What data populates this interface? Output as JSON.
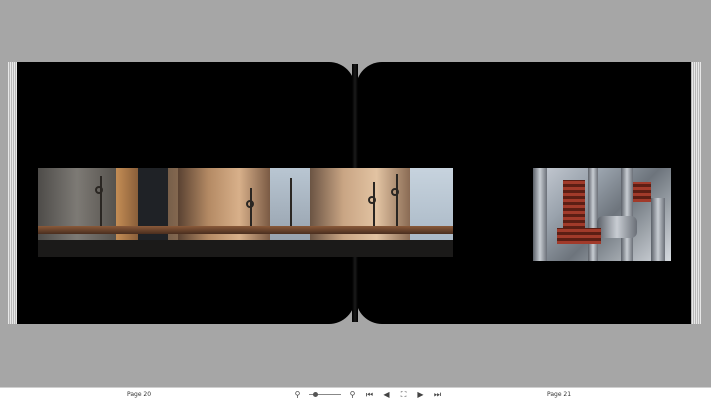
{
  "viewer": {
    "left_page_label": "Page 20",
    "right_page_label": "Page 21"
  },
  "toolbar": {
    "zoom_out_icon": "zoom-out-icon",
    "zoom_in_icon": "zoom-in-icon",
    "zoom_level": 0.15,
    "buttons": [
      {
        "name": "first-page-icon",
        "glyph": "⏮"
      },
      {
        "name": "previous-page-icon",
        "glyph": "◀"
      },
      {
        "name": "fit-page-icon",
        "glyph": "⛶"
      },
      {
        "name": "next-page-icon",
        "glyph": "▶"
      },
      {
        "name": "last-page-icon",
        "glyph": "⏭"
      }
    ],
    "zoom_out_glyph": "⚲",
    "zoom_in_glyph": "⚲"
  }
}
